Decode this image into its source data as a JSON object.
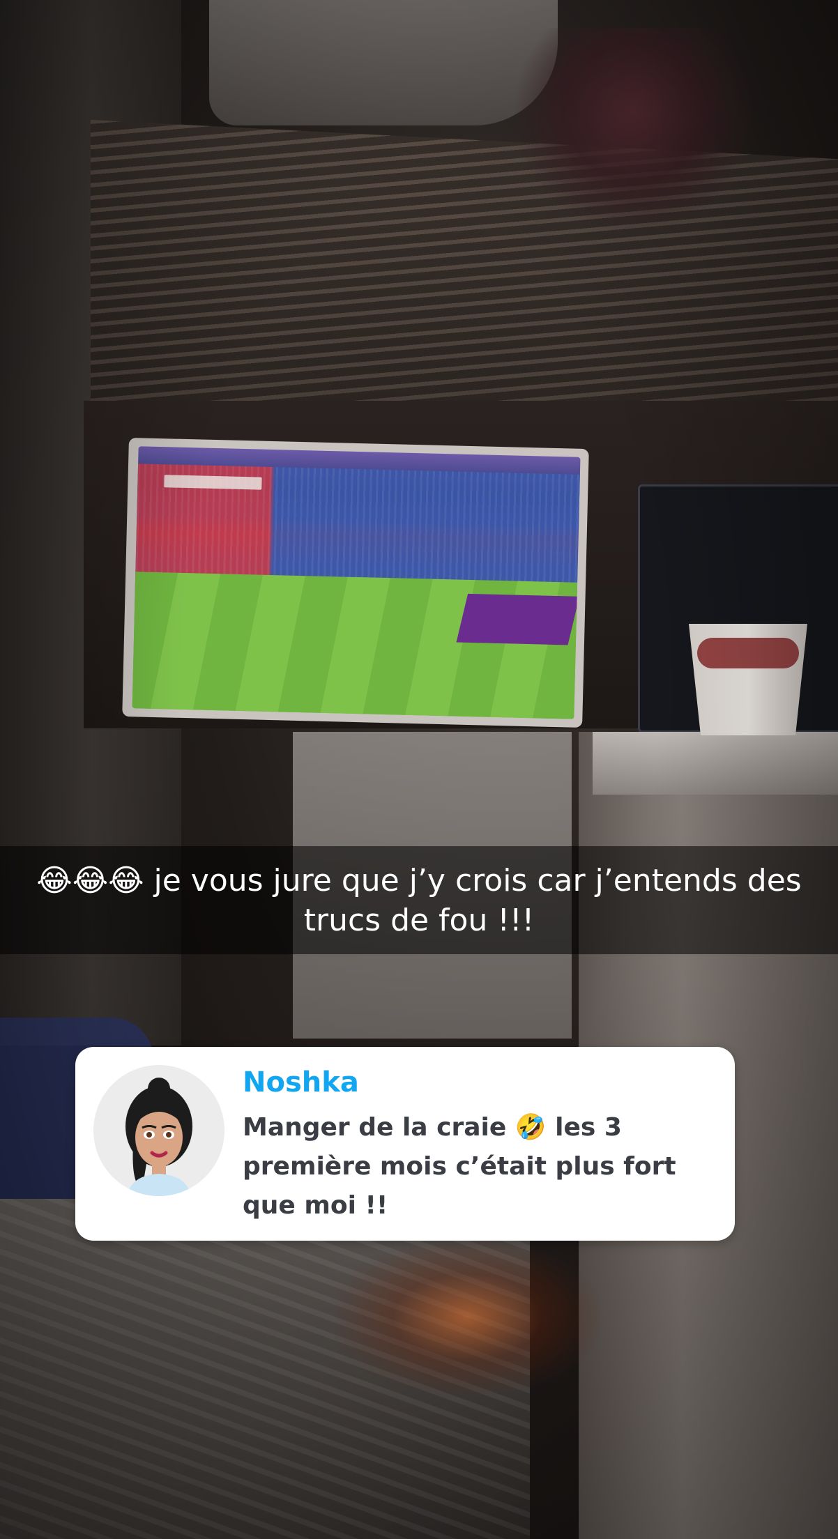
{
  "caption": {
    "text": "😂😂😂 je vous jure que j’y crois car j’entends des trucs de fou !!!"
  },
  "reply": {
    "name": "Noshka",
    "message": "Manger de la craie 🤣 les 3 première mois c’était plus fort que moi !!",
    "name_color": "#12a6f0"
  },
  "icons": {
    "avatar": "bitmoji-avatar"
  }
}
